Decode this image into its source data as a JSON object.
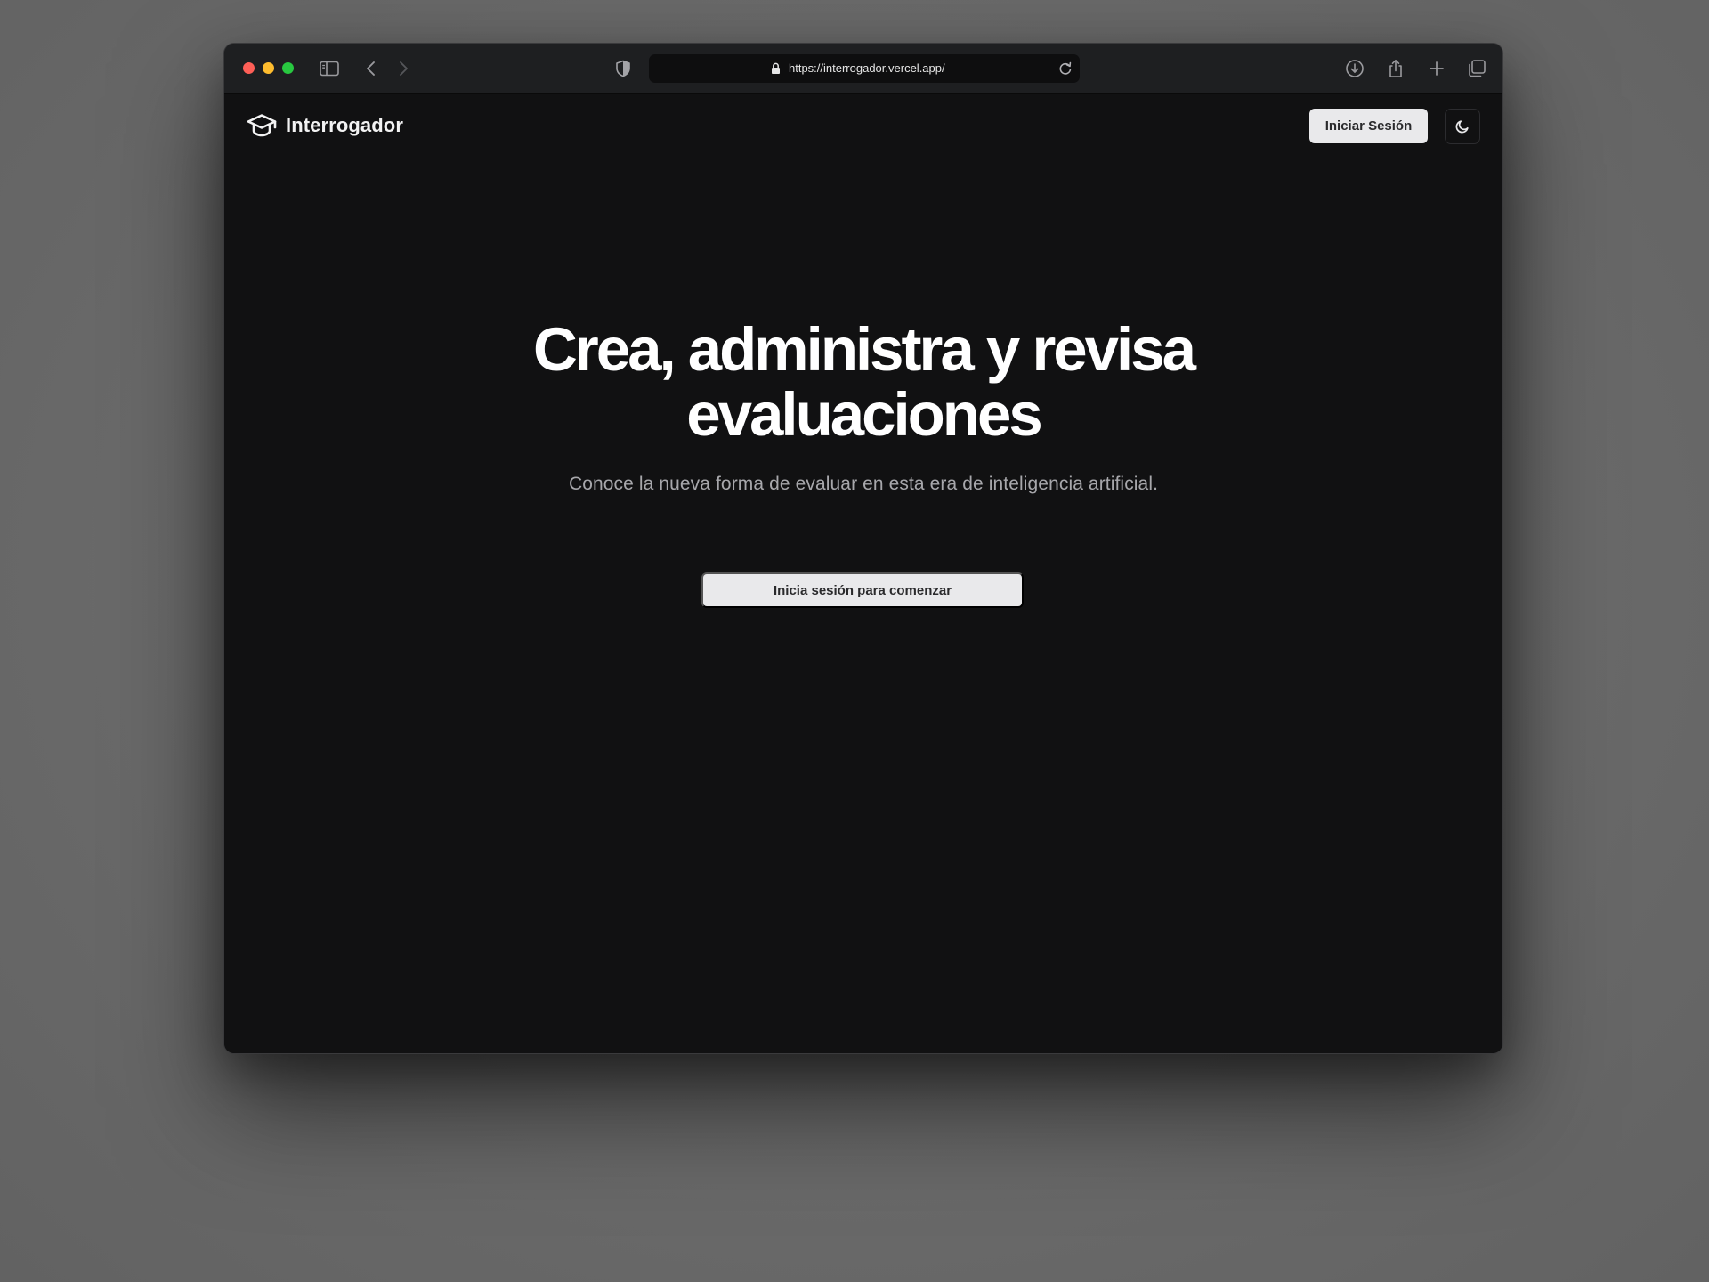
{
  "browser": {
    "url": "https://interrogador.vercel.app/",
    "icons": [
      "sidebar-icon",
      "back-icon",
      "forward-icon",
      "privacy-shield-icon",
      "lock-icon",
      "reload-icon",
      "download-icon",
      "share-icon",
      "new-tab-icon",
      "tabs-overview-icon"
    ]
  },
  "header": {
    "brand_name": "Interrogador",
    "brand_icon": "graduation-cap-icon",
    "login_label": "Iniciar Sesión",
    "theme_icon": "moon-icon"
  },
  "hero": {
    "title_line1": "Crea, administra y revisa",
    "title_line2": "evaluaciones",
    "subtitle": "Conoce la nueva forma de evaluar en esta era de inteligencia artificial.",
    "cta_label": "Inicia sesión para comenzar"
  },
  "colors": {
    "page_background": "#111112",
    "toolbar_background": "#1e1f21",
    "button_background": "#e9e9eb",
    "subtitle_text": "#a7a7ab",
    "desktop_background": "#6b6b6b"
  }
}
